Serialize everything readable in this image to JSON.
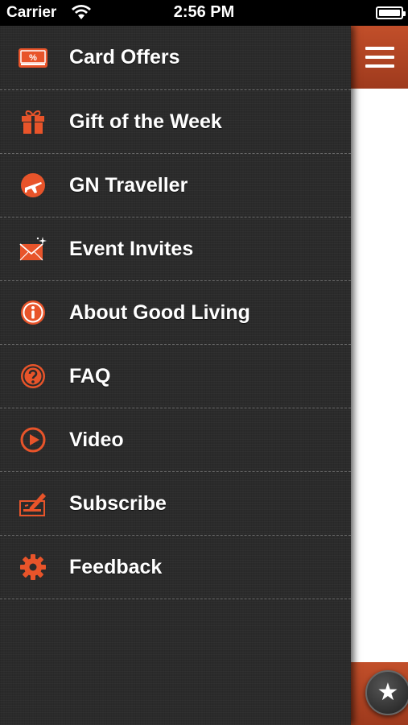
{
  "status_bar": {
    "carrier": "Carrier",
    "time": "2:56 PM"
  },
  "colors": {
    "accent": "#e8542a",
    "drawer_bg": "#2b2b2b",
    "header_bar": "#b4471f"
  },
  "menu": {
    "items": [
      {
        "label": "Card Offers",
        "icon": "card-offers-icon"
      },
      {
        "label": "Gift of the Week",
        "icon": "gift-icon"
      },
      {
        "label": "GN Traveller",
        "icon": "plane-icon"
      },
      {
        "label": "Event Invites",
        "icon": "envelope-icon"
      },
      {
        "label": "About Good Living",
        "icon": "info-icon"
      },
      {
        "label": "FAQ",
        "icon": "question-icon"
      },
      {
        "label": "Video",
        "icon": "play-icon"
      },
      {
        "label": "Subscribe",
        "icon": "subscribe-icon"
      },
      {
        "label": "Feedback",
        "icon": "gear-icon"
      }
    ]
  },
  "content": {
    "menu_button_icon": "hamburger-icon",
    "favorite_button_icon": "star-icon",
    "favorite_glyph": "★"
  }
}
